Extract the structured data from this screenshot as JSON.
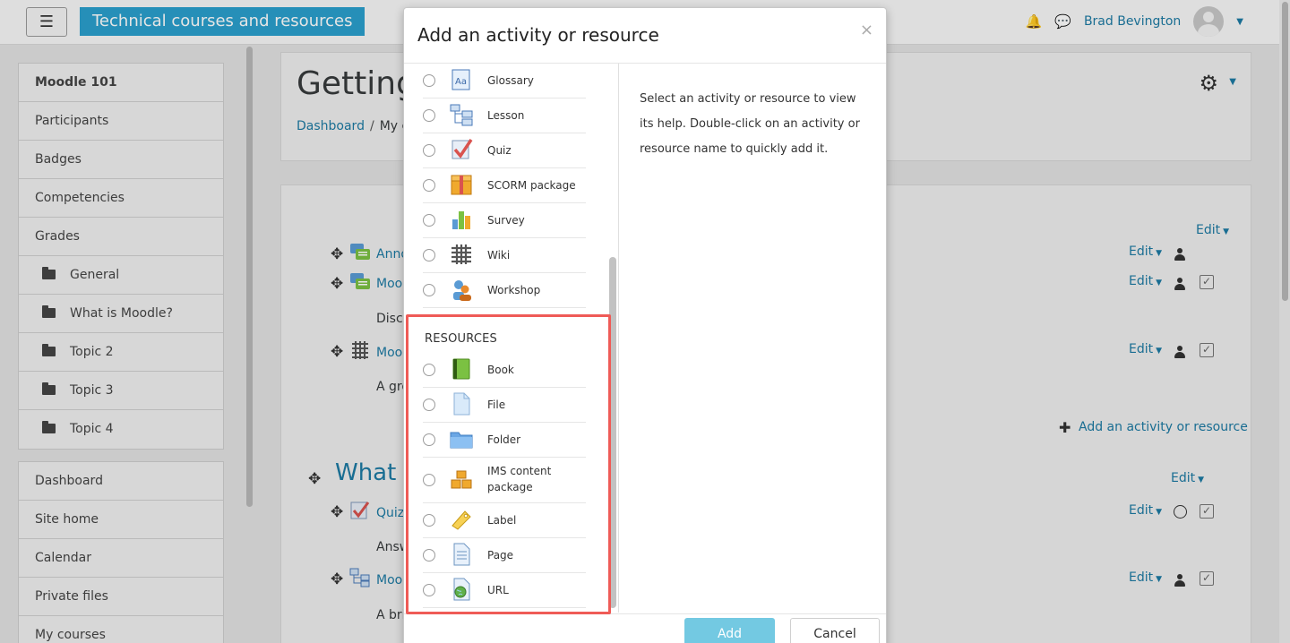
{
  "navbar": {
    "menu_icon": "hamburger-icon",
    "brand": "Technical courses and resources",
    "notifications_icon": "bell-icon",
    "messages_icon": "chat-icon",
    "username": "Brad Bevington"
  },
  "drawer": {
    "course_items": [
      "Moodle 101",
      "Participants",
      "Badges",
      "Competencies",
      "Grades",
      "General",
      "What is Moodle?",
      "Topic 2",
      "Topic 3",
      "Topic 4"
    ],
    "site_items": [
      "Dashboard",
      "Site home",
      "Calendar",
      "Private files",
      "My courses"
    ]
  },
  "header": {
    "title": "Getting",
    "breadcrumb_home": "Dashboard",
    "breadcrumb_sep": "/",
    "breadcrumb_current": "My c"
  },
  "course": {
    "edit": "Edit",
    "activities_top": [
      "Anno",
      "Moo",
      "Moo"
    ],
    "desc_1": "Discu",
    "desc_2": "A gro",
    "add_activity": "Add an activity or resource",
    "section_title": "What is",
    "activities_bottom": [
      "Quiz",
      "Moo"
    ],
    "desc_3": "Answ",
    "desc_4": "A bri"
  },
  "modal": {
    "title": "Add an activity or resource",
    "close": "×",
    "activities": [
      {
        "label": "Glossary",
        "icon": "glossary-icon"
      },
      {
        "label": "Lesson",
        "icon": "lesson-icon"
      },
      {
        "label": "Quiz",
        "icon": "quiz-icon"
      },
      {
        "label": "SCORM package",
        "icon": "scorm-icon"
      },
      {
        "label": "Survey",
        "icon": "survey-icon"
      },
      {
        "label": "Wiki",
        "icon": "wiki-icon"
      },
      {
        "label": "Workshop",
        "icon": "workshop-icon"
      }
    ],
    "resources_heading": "RESOURCES",
    "resources": [
      {
        "label": "Book",
        "icon": "book-icon"
      },
      {
        "label": "File",
        "icon": "file-icon"
      },
      {
        "label": "Folder",
        "icon": "folder-icon"
      },
      {
        "label": "IMS content package",
        "line1": "IMS content",
        "line2": "package",
        "icon": "ims-package-icon"
      },
      {
        "label": "Label",
        "icon": "label-icon"
      },
      {
        "label": "Page",
        "icon": "page-icon"
      },
      {
        "label": "URL",
        "icon": "url-icon"
      }
    ],
    "help_text": "Select an activity or resource to view its help. Double-click on an activity or resource name to quickly add it.",
    "add_button": "Add",
    "cancel_button": "Cancel"
  },
  "colors": {
    "brand": "#2ba0cd",
    "link": "#1c7aa3",
    "highlight": "#ef5b57",
    "add_button": "#5bc0de"
  }
}
